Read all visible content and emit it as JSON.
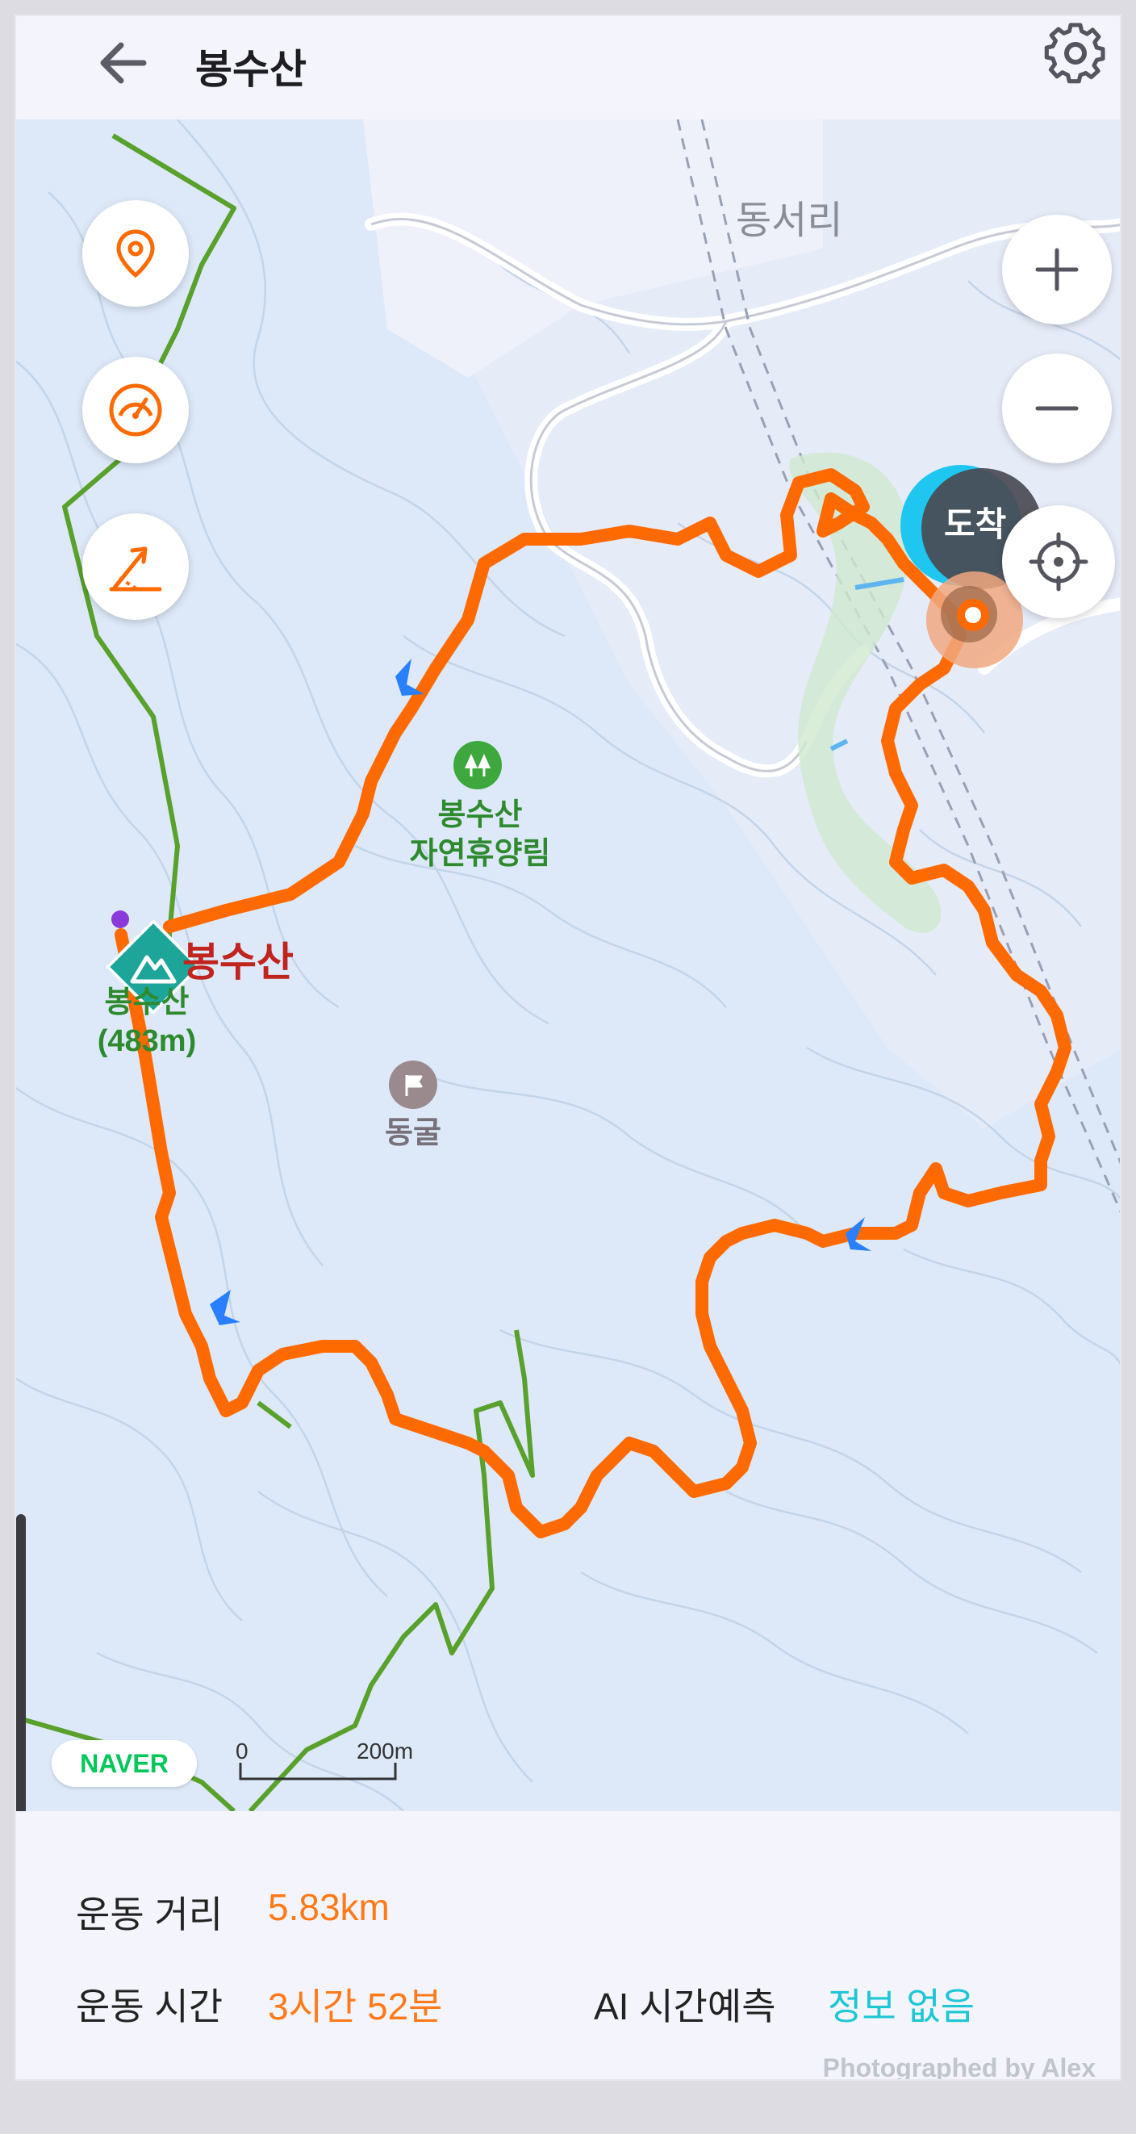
{
  "header": {
    "title": "봉수산"
  },
  "map": {
    "labels": {
      "village": "동서리",
      "forest_line1": "봉수산",
      "forest_line2": "자연휴양림",
      "peak_name": "봉수산",
      "peak_sub1": "봉수산",
      "peak_sub2": "(483m)",
      "cave": "동굴",
      "arrival": "도착"
    },
    "naver_logo": "NAVER",
    "scale": {
      "start": "0",
      "end": "200m"
    },
    "icons": {
      "location_pin": "location-pin-icon",
      "speedometer": "speedometer-icon",
      "altitude": "altitude-icon",
      "zoom_in": "plus-icon",
      "zoom_out": "minus-icon",
      "locate": "crosshair-icon"
    },
    "colors": {
      "route": "#ff6a00",
      "trail": "#5aa02c",
      "forest_marker": "#3ea83e",
      "peak_marker": "#1ea59a",
      "accent_cyan": "#1ec6d6"
    }
  },
  "stats": {
    "distance_label": "운동 거리",
    "distance_value": "5.83km",
    "time_label": "운동 시간",
    "time_value": "3시간 52분",
    "ai_label": "AI 시간예측",
    "ai_value": "정보 없음"
  },
  "watermark": "Photographed by Alex"
}
